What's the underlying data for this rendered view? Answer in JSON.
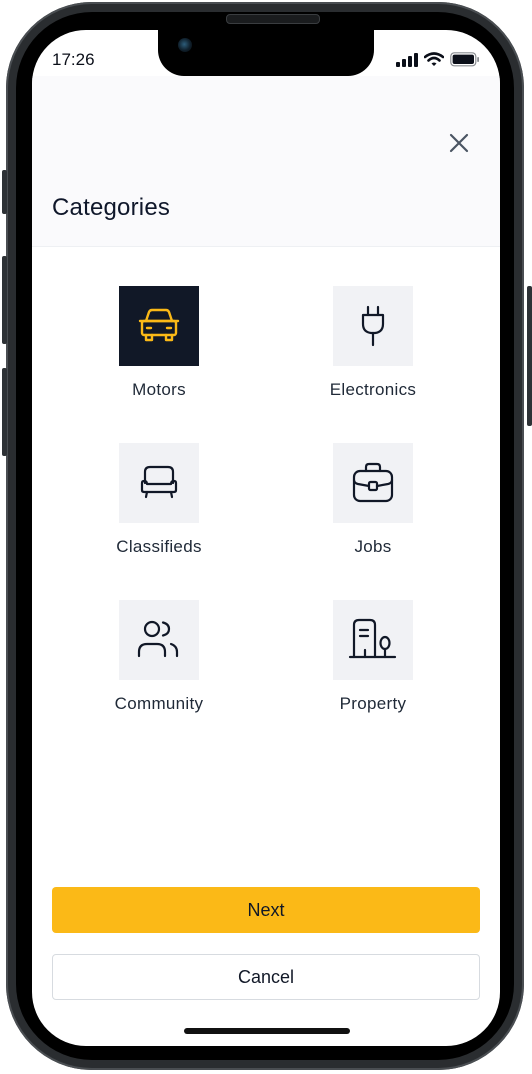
{
  "status_bar": {
    "time": "17:26",
    "icons": [
      "cellular-signal-icon",
      "wifi-icon",
      "battery-icon"
    ]
  },
  "header": {
    "title": "Categories",
    "close_icon": "close-icon"
  },
  "categories": [
    {
      "label": "Motors",
      "icon": "car-icon",
      "selected": true
    },
    {
      "label": "Electronics",
      "icon": "plug-icon",
      "selected": false
    },
    {
      "label": "Classifieds",
      "icon": "sofa-icon",
      "selected": false
    },
    {
      "label": "Jobs",
      "icon": "briefcase-icon",
      "selected": false
    },
    {
      "label": "Community",
      "icon": "users-icon",
      "selected": false
    },
    {
      "label": "Property",
      "icon": "building-icon",
      "selected": false
    }
  ],
  "actions": {
    "next_label": "Next",
    "cancel_label": "Cancel"
  },
  "colors": {
    "accent": "#fbb917",
    "selected_tile": "#111827",
    "selected_icon": "#fbb917",
    "tile": "#f1f2f5",
    "text": "#111827"
  }
}
